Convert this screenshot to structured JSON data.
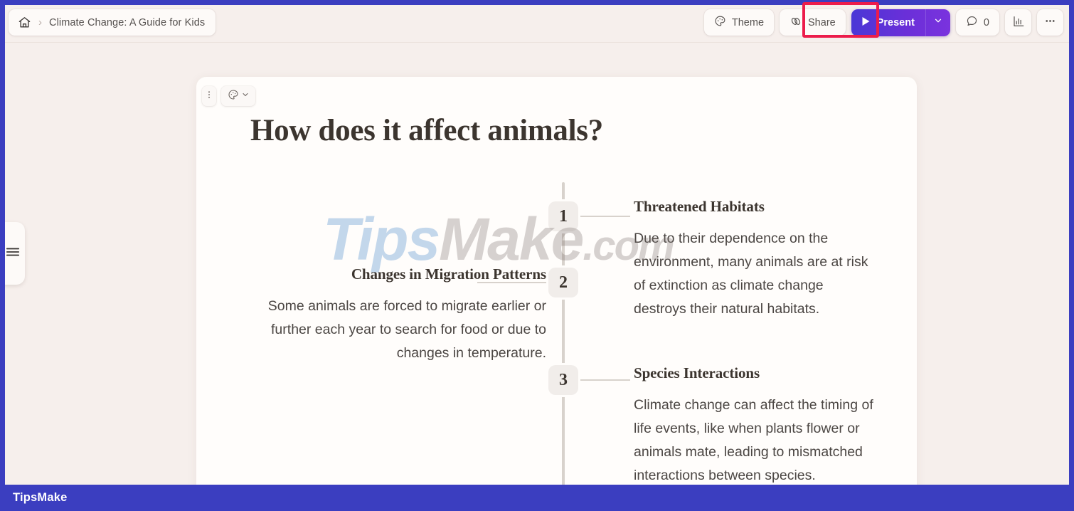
{
  "breadcrumb": {
    "home_icon": "home-icon",
    "separator": "›",
    "title": "Climate Change: A Guide for Kids"
  },
  "toolbar": {
    "theme_label": "Theme",
    "theme_icon": "palette-icon",
    "share_label": "Share",
    "share_icon": "link-chain-icon",
    "present_label": "Present",
    "present_play_icon": "play-icon",
    "present_caret_icon": "chevron-down-icon",
    "comment_icon": "comment-bubble-icon",
    "comment_count": "0",
    "analytics_icon": "bar-chart-icon",
    "more_icon": "ellipsis-horizontal-icon",
    "accent_present_start": "#4a37d6",
    "accent_present_end": "#7a33de",
    "highlight_color": "#ec1c4b"
  },
  "sidebar": {
    "toggle_icon": "hamburger-menu-icon"
  },
  "slide": {
    "kebab_icon": "ellipsis-vertical-icon",
    "theme_icon": "palette-icon",
    "theme_caret_icon": "chevron-down-icon",
    "title": "How does it affect animals?",
    "items": [
      {
        "number": "1",
        "heading": "Threatened Habitats",
        "body": "Due to their dependence on the environment, many animals are at risk of extinction as climate change destroys their natural habitats."
      },
      {
        "number": "2",
        "heading": "Changes in Migration Patterns",
        "body": "Some animals are forced to migrate earlier or further each year to search for food or due to changes in temperature."
      },
      {
        "number": "3",
        "heading": "Species Interactions",
        "body": "Climate change can affect the timing of life events, like when plants flower or animals mate, leading to mismatched interactions between species."
      }
    ]
  },
  "watermark": {
    "part1": "Tips",
    "part2": "Make",
    "part3": ".com"
  },
  "footer": {
    "logo": "TipsMake",
    "background": "#3b3ec0"
  }
}
